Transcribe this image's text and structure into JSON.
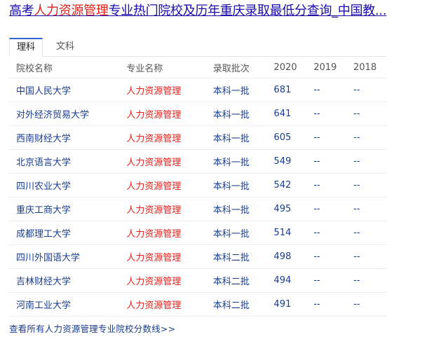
{
  "title": {
    "prefix": "高考",
    "highlight": "人力资源管理",
    "suffix": "专业热门院校及历年重庆录取最低分查询_中国教..."
  },
  "tabs": [
    {
      "label": "理科",
      "active": true
    },
    {
      "label": "文科",
      "active": false
    }
  ],
  "table": {
    "headers": [
      "院校名称",
      "专业名称",
      "录取批次",
      "2020",
      "2019",
      "2018"
    ],
    "rows": [
      {
        "school": "中国人民大学",
        "major": "人力资源管理",
        "batch": "本科一批",
        "y2020": "681",
        "y2019": "--",
        "y2018": "--"
      },
      {
        "school": "对外经济贸易大学",
        "major": "人力资源管理",
        "batch": "本科一批",
        "y2020": "641",
        "y2019": "--",
        "y2018": "--"
      },
      {
        "school": "西南财经大学",
        "major": "人力资源管理",
        "batch": "本科一批",
        "y2020": "605",
        "y2019": "--",
        "y2018": "--"
      },
      {
        "school": "北京语言大学",
        "major": "人力资源管理",
        "batch": "本科一批",
        "y2020": "549",
        "y2019": "--",
        "y2018": "--"
      },
      {
        "school": "四川农业大学",
        "major": "人力资源管理",
        "batch": "本科一批",
        "y2020": "542",
        "y2019": "--",
        "y2018": "--"
      },
      {
        "school": "重庆工商大学",
        "major": "人力资源管理",
        "batch": "本科一批",
        "y2020": "495",
        "y2019": "--",
        "y2018": "--"
      },
      {
        "school": "成都理工大学",
        "major": "人力资源管理",
        "batch": "本科一批",
        "y2020": "514",
        "y2019": "--",
        "y2018": "--"
      },
      {
        "school": "四川外国语大学",
        "major": "人力资源管理",
        "batch": "本科二批",
        "y2020": "498",
        "y2019": "--",
        "y2018": "--"
      },
      {
        "school": "吉林财经大学",
        "major": "人力资源管理",
        "batch": "本科二批",
        "y2020": "494",
        "y2019": "--",
        "y2018": "--"
      },
      {
        "school": "河南工业大学",
        "major": "人力资源管理",
        "batch": "本科二批",
        "y2020": "491",
        "y2019": "--",
        "y2018": "--"
      }
    ]
  },
  "more_link": "查看所有人力资源管理专业院校分数线>>",
  "colors": {
    "link": "#1a0dab",
    "highlight": "#e0211a",
    "cell_text": "#1a3d8f",
    "tab_accent": "#3366cc"
  }
}
